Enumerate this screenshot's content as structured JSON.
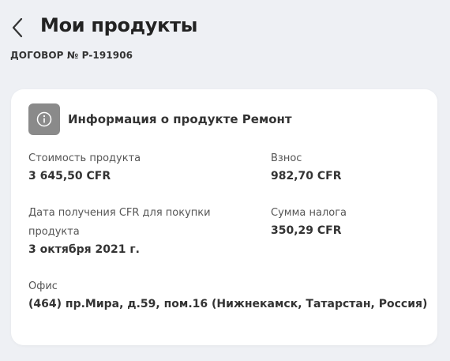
{
  "header": {
    "title": "Мои продукты",
    "contract": "ДОГОВОР № P-191906",
    "back_icon": "chevron-left-icon"
  },
  "card": {
    "icon": "info-icon",
    "title": "Информация о продукте Ремонт",
    "fields": [
      {
        "label": "Стоимость продукта",
        "value": "3 645,50 CFR"
      },
      {
        "label": "Взнос",
        "value": "982,70 CFR"
      },
      {
        "label": "Дата получения CFR для покупки продукта",
        "value": "3 октября 2021 г."
      },
      {
        "label": "Сумма налога",
        "value": "350,29 CFR"
      },
      {
        "label": "Офис",
        "value": "(464) пр.Мира, д.59, пом.16 (Нижнекамск, Татарстан, Россия)"
      }
    ]
  },
  "colors": {
    "background": "#eef0f4",
    "card": "#ffffff",
    "icon_badge": "#8a8a8a"
  }
}
